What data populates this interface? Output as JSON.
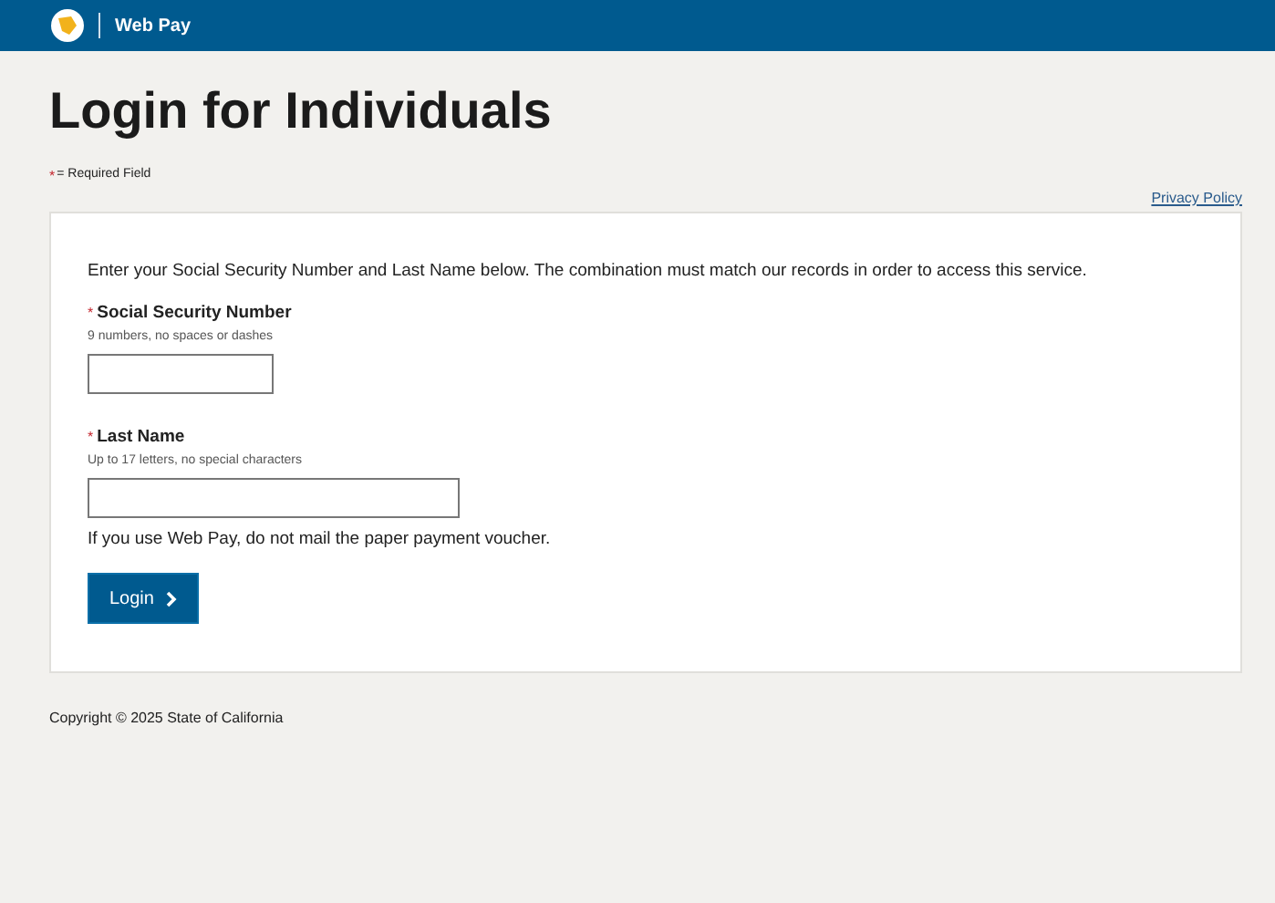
{
  "header": {
    "title": "Web Pay"
  },
  "page": {
    "heading": "Login for Individuals",
    "required_note": {
      "mark": "*",
      "text": "= Required Field"
    },
    "privacy_link": "Privacy Policy"
  },
  "form": {
    "intro": "Enter your Social Security Number and Last Name below. The combination must match our records in order to access this service.",
    "fields": [
      {
        "mark": "*",
        "label": "Social Security Number",
        "hint": "9 numbers, no spaces or dashes"
      },
      {
        "mark": "*",
        "label": "Last Name",
        "hint": "Up to 17 letters, no special characters"
      }
    ],
    "notice": "If you use Web Pay, do not mail the paper payment voucher.",
    "submit": "Login"
  },
  "footer": {
    "copyright": "Copyright © 2025 State of California"
  }
}
